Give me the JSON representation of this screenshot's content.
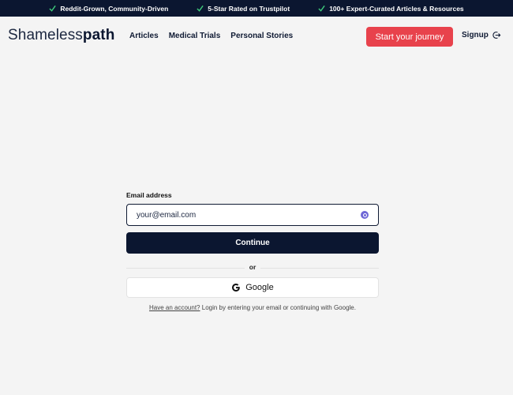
{
  "topbar": {
    "items": [
      {
        "label": "Reddit-Grown, Community-Driven",
        "icon": "check-icon"
      },
      {
        "label": "5-Star Rated on Trustpilot",
        "icon": "check-icon"
      },
      {
        "label": "100+ Expert-Curated Articles & Resources",
        "icon": "check-icon"
      }
    ]
  },
  "header": {
    "logo_light": "Shameless",
    "logo_bold": "path",
    "nav": [
      "Articles",
      "Medical Trials",
      "Personal Stories"
    ],
    "cta_label": "Start your journey",
    "signup_label": "Signup",
    "signup_icon": "login-icon"
  },
  "form": {
    "email_label": "Email address",
    "email_placeholder": "your@email.com",
    "password_manager_icon": "password-manager-icon",
    "continue_label": "Continue",
    "or_text": "or",
    "google_label": "Google",
    "google_icon": "google-icon",
    "help_link": "Have an account?",
    "help_text": " Login by entering your email or continuing with Google."
  },
  "colors": {
    "navy": "#0b1630",
    "accent_red": "#e8424c",
    "background": "#f4f4f4"
  }
}
